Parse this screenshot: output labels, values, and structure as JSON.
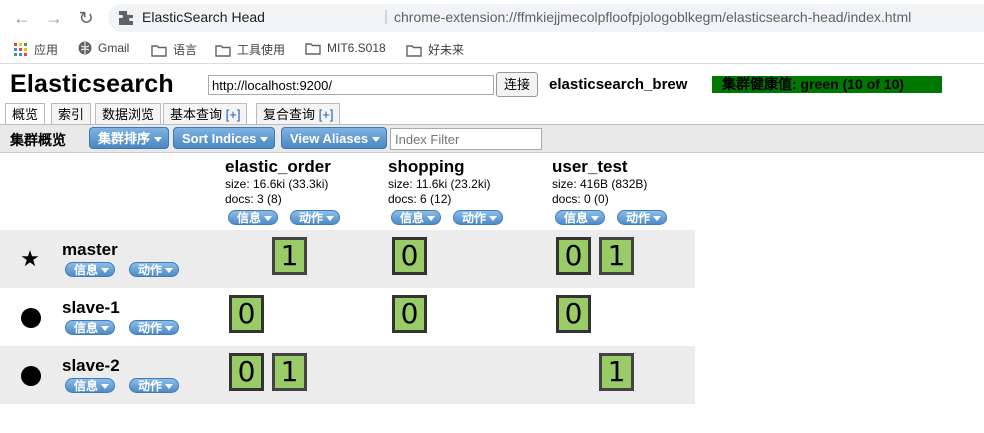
{
  "browser": {
    "tab_title": "ElasticSearch Head",
    "url": "chrome-extension://ffmkiejjmecolpfloofpjologoblkegm/elasticsearch-head/index.html",
    "bookmarks": [
      "应用",
      "Gmail",
      "语言",
      "工具使用",
      "MIT6.S018",
      "好未来"
    ]
  },
  "app": {
    "title": "Elasticsearch",
    "connect_url": "http://localhost:9200/",
    "connect_label": "连接",
    "cluster_name": "elasticsearch_brew",
    "health": "集群健康值: green (10 of 10)",
    "health_color": "#007700"
  },
  "tabs": [
    {
      "label": "概览",
      "plus": ""
    },
    {
      "label": "索引",
      "plus": ""
    },
    {
      "label": "数据浏览",
      "plus": ""
    },
    {
      "label": "基本查询",
      "plus": "[+]"
    },
    {
      "label": "复合查询",
      "plus": "[+]"
    }
  ],
  "toolbar": {
    "title": "集群概览",
    "sort_cluster": "集群排序",
    "sort_indices": "Sort Indices",
    "view_aliases": "View Aliases",
    "filter_placeholder": "Index Filter"
  },
  "indices": [
    {
      "name": "elastic_order",
      "size": "size: 16.6ki (33.3ki)",
      "docs": "docs: 3 (8)",
      "info": "信息",
      "action": "动作"
    },
    {
      "name": "shopping",
      "size": "size: 11.6ki (23.2ki)",
      "docs": "docs: 6 (12)",
      "info": "信息",
      "action": "动作"
    },
    {
      "name": "user_test",
      "size": "size: 416B (832B)",
      "docs": "docs: 0 (0)",
      "info": "信息",
      "action": "动作"
    }
  ],
  "nodes": [
    {
      "name": "master",
      "icon": "star-icon",
      "info": "信息",
      "action": "动作"
    },
    {
      "name": "slave-1",
      "icon": "circle-icon",
      "info": "信息",
      "action": "动作"
    },
    {
      "name": "slave-2",
      "icon": "circle-icon",
      "info": "信息",
      "action": "动作"
    }
  ],
  "shards": {
    "master": {
      "elastic_order": [
        "",
        "1"
      ],
      "shopping": [
        "0",
        ""
      ],
      "user_test": [
        "0",
        "1"
      ]
    },
    "slave_1": {
      "elastic_order": [
        "0",
        ""
      ],
      "shopping": [
        "0",
        ""
      ],
      "user_test": [
        "0",
        ""
      ]
    },
    "slave_2": {
      "elastic_order": [
        "0",
        "1"
      ],
      "shopping": [
        "",
        ""
      ],
      "user_test": [
        "",
        "1"
      ]
    }
  }
}
